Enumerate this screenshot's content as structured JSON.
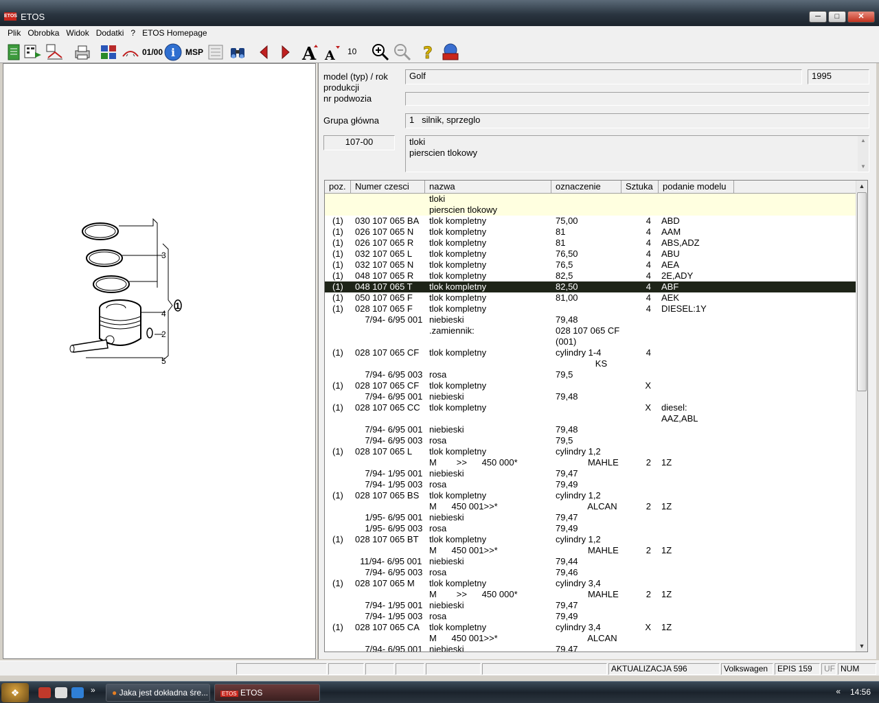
{
  "window": {
    "title": "ETOS",
    "logo": "ETOS"
  },
  "menu": [
    "Plik",
    "Obrobka",
    "Widok",
    "Dodatki",
    "?",
    "ETOS Homepage"
  ],
  "toolbar": {
    "font_size": "10",
    "msp_label": "MSP",
    "counter_label": "01/00"
  },
  "header": {
    "model_label": "model (typ) / rok produkcji",
    "model_value": "Golf",
    "year_value": "1995",
    "chassis_label": "nr podwozia",
    "chassis_value": "",
    "group_label": "Grupa główna",
    "group_value": "1   silnik, sprzeglo",
    "subgroup_code": "107-00",
    "subgroup_line1": "tloki",
    "subgroup_line2": "pierscien tlokowy"
  },
  "diagram": {
    "callout_1": "1",
    "callout_2": "2",
    "callout_3": "3",
    "callout_4": "4",
    "callout_5": "5"
  },
  "table": {
    "columns": [
      "poz.",
      "Numer czesci",
      "nazwa",
      "oznaczenie",
      "Sztuka",
      "podanie modelu"
    ],
    "rows": [
      {
        "poz": "",
        "nr": "",
        "nazwa": "tloki",
        "ozn": "",
        "szt": "",
        "pod": "",
        "style": "hl-yellow"
      },
      {
        "poz": "",
        "nr": "",
        "nazwa": "pierscien tlokowy",
        "ozn": "",
        "szt": "",
        "pod": "",
        "style": "hl-yellow"
      },
      {
        "poz": "(1)",
        "nr": "030 107 065 BA",
        "nazwa": "tlok kompletny",
        "ozn": "75,00",
        "szt": "4",
        "pod": "ABD"
      },
      {
        "poz": "(1)",
        "nr": "026 107 065 N",
        "nazwa": "tlok kompletny",
        "ozn": "81",
        "szt": "4",
        "pod": "AAM"
      },
      {
        "poz": "(1)",
        "nr": "026 107 065 R",
        "nazwa": "tlok kompletny",
        "ozn": "81",
        "szt": "4",
        "pod": "ABS,ADZ"
      },
      {
        "poz": "(1)",
        "nr": "032 107 065 L",
        "nazwa": "tlok kompletny",
        "ozn": "76,50",
        "szt": "4",
        "pod": "ABU"
      },
      {
        "poz": "(1)",
        "nr": "032 107 065 N",
        "nazwa": "tlok kompletny",
        "ozn": "76,5",
        "szt": "4",
        "pod": "AEA"
      },
      {
        "poz": "(1)",
        "nr": "048 107 065 R",
        "nazwa": "tlok kompletny",
        "ozn": "82,5",
        "szt": "4",
        "pod": "2E,ADY"
      },
      {
        "poz": "(1)",
        "nr": "048 107 065 T",
        "nazwa": "tlok kompletny",
        "ozn": "82,50",
        "szt": "4",
        "pod": "ABF",
        "style": "selected"
      },
      {
        "poz": "(1)",
        "nr": "050 107 065 F",
        "nazwa": "tlok kompletny",
        "ozn": "81,00",
        "szt": "4",
        "pod": "AEK"
      },
      {
        "poz": "(1)",
        "nr": "028 107 065 F",
        "nazwa": "tlok kompletny",
        "ozn": "",
        "szt": "4",
        "pod": "DIESEL:1Y"
      },
      {
        "poz": "",
        "nr": "    7/94- 6/95 001",
        "nazwa": "niebieski",
        "ozn": "79,48",
        "szt": "",
        "pod": ""
      },
      {
        "poz": "",
        "nr": "",
        "nazwa": ".zamiennik:",
        "ozn": "028 107 065 CF",
        "szt": "",
        "pod": ""
      },
      {
        "poz": "",
        "nr": "",
        "nazwa": "",
        "ozn": "(001)",
        "szt": "",
        "pod": ""
      },
      {
        "poz": "(1)",
        "nr": "028 107 065 CF",
        "nazwa": "tlok kompletny",
        "ozn": "cylindry 1-4",
        "szt": "4",
        "pod": ""
      },
      {
        "poz": "",
        "nr": "",
        "nazwa": "",
        "ozn": "                KS",
        "szt": "",
        "pod": ""
      },
      {
        "poz": "",
        "nr": "    7/94- 6/95 003",
        "nazwa": "rosa",
        "ozn": "79,5",
        "szt": "",
        "pod": ""
      },
      {
        "poz": "(1)",
        "nr": "028 107 065 CF",
        "nazwa": "tlok kompletny",
        "ozn": "",
        "szt": "X",
        "pod": ""
      },
      {
        "poz": "",
        "nr": "    7/94- 6/95 001",
        "nazwa": "niebieski",
        "ozn": "79,48",
        "szt": "",
        "pod": ""
      },
      {
        "poz": "(1)",
        "nr": "028 107 065 CC",
        "nazwa": "tlok kompletny",
        "ozn": "",
        "szt": "X",
        "pod": "diesel:"
      },
      {
        "poz": "",
        "nr": "",
        "nazwa": "",
        "ozn": "",
        "szt": "",
        "pod": "AAZ,ABL"
      },
      {
        "poz": "",
        "nr": "    7/94- 6/95 001",
        "nazwa": "niebieski",
        "ozn": "79,48",
        "szt": "",
        "pod": ""
      },
      {
        "poz": "",
        "nr": "    7/94- 6/95 003",
        "nazwa": "rosa",
        "ozn": "79,5",
        "szt": "",
        "pod": ""
      },
      {
        "poz": "(1)",
        "nr": "028 107 065 L",
        "nazwa": "tlok kompletny",
        "ozn": "cylindry 1,2",
        "szt": "",
        "pod": ""
      },
      {
        "poz": "",
        "nr": "",
        "nazwa": "M        >>      450 000*",
        "ozn": "             MAHLE",
        "szt": "2",
        "pod": "1Z"
      },
      {
        "poz": "",
        "nr": "    7/94- 1/95 001",
        "nazwa": "niebieski",
        "ozn": "79,47",
        "szt": "",
        "pod": ""
      },
      {
        "poz": "",
        "nr": "    7/94- 1/95 003",
        "nazwa": "rosa",
        "ozn": "79,49",
        "szt": "",
        "pod": ""
      },
      {
        "poz": "(1)",
        "nr": "028 107 065 BS",
        "nazwa": "tlok kompletny",
        "ozn": "cylindry 1,2",
        "szt": "",
        "pod": ""
      },
      {
        "poz": "",
        "nr": "",
        "nazwa": "M      450 001>>*",
        "ozn": "             ALCAN",
        "szt": "2",
        "pod": "1Z"
      },
      {
        "poz": "",
        "nr": "    1/95- 6/95 001",
        "nazwa": "niebieski",
        "ozn": "79,47",
        "szt": "",
        "pod": ""
      },
      {
        "poz": "",
        "nr": "    1/95- 6/95 003",
        "nazwa": "rosa",
        "ozn": "79,49",
        "szt": "",
        "pod": ""
      },
      {
        "poz": "(1)",
        "nr": "028 107 065 BT",
        "nazwa": "tlok kompletny",
        "ozn": "cylindry 1,2",
        "szt": "",
        "pod": ""
      },
      {
        "poz": "",
        "nr": "",
        "nazwa": "M      450 001>>*",
        "ozn": "             MAHLE",
        "szt": "2",
        "pod": "1Z"
      },
      {
        "poz": "",
        "nr": "  11/94- 6/95 001",
        "nazwa": "niebieski",
        "ozn": "79,44",
        "szt": "",
        "pod": ""
      },
      {
        "poz": "",
        "nr": "    7/94- 6/95 003",
        "nazwa": "rosa",
        "ozn": "79,46",
        "szt": "",
        "pod": ""
      },
      {
        "poz": "(1)",
        "nr": "028 107 065 M",
        "nazwa": "tlok kompletny",
        "ozn": "cylindry 3,4",
        "szt": "",
        "pod": ""
      },
      {
        "poz": "",
        "nr": "",
        "nazwa": "M        >>      450 000*",
        "ozn": "             MAHLE",
        "szt": "2",
        "pod": "1Z"
      },
      {
        "poz": "",
        "nr": "    7/94- 1/95 001",
        "nazwa": "niebieski",
        "ozn": "79,47",
        "szt": "",
        "pod": ""
      },
      {
        "poz": "",
        "nr": "    7/94- 1/95 003",
        "nazwa": "rosa",
        "ozn": "79,49",
        "szt": "",
        "pod": ""
      },
      {
        "poz": "(1)",
        "nr": "028 107 065 CA",
        "nazwa": "tlok kompletny",
        "ozn": "cylindry 3,4",
        "szt": "X",
        "pod": "1Z"
      },
      {
        "poz": "",
        "nr": "",
        "nazwa": "M      450 001>>*",
        "ozn": "             ALCAN",
        "szt": "",
        "pod": ""
      },
      {
        "poz": "",
        "nr": "    7/94- 6/95 001",
        "nazwa": "niebieski",
        "ozn": "79,47",
        "szt": "",
        "pod": ""
      }
    ]
  },
  "statusbar": {
    "update": "AKTUALIZACJA 596",
    "brand": "Volkswagen",
    "epis": "EPIS 159",
    "uf": "UF",
    "num": "NUM"
  },
  "taskbar": {
    "task1": "Jaka jest dokładna śre...",
    "task2": "ETOS",
    "clock": "14:56",
    "tray_chevron": "«",
    "ql_chevron": "»"
  }
}
